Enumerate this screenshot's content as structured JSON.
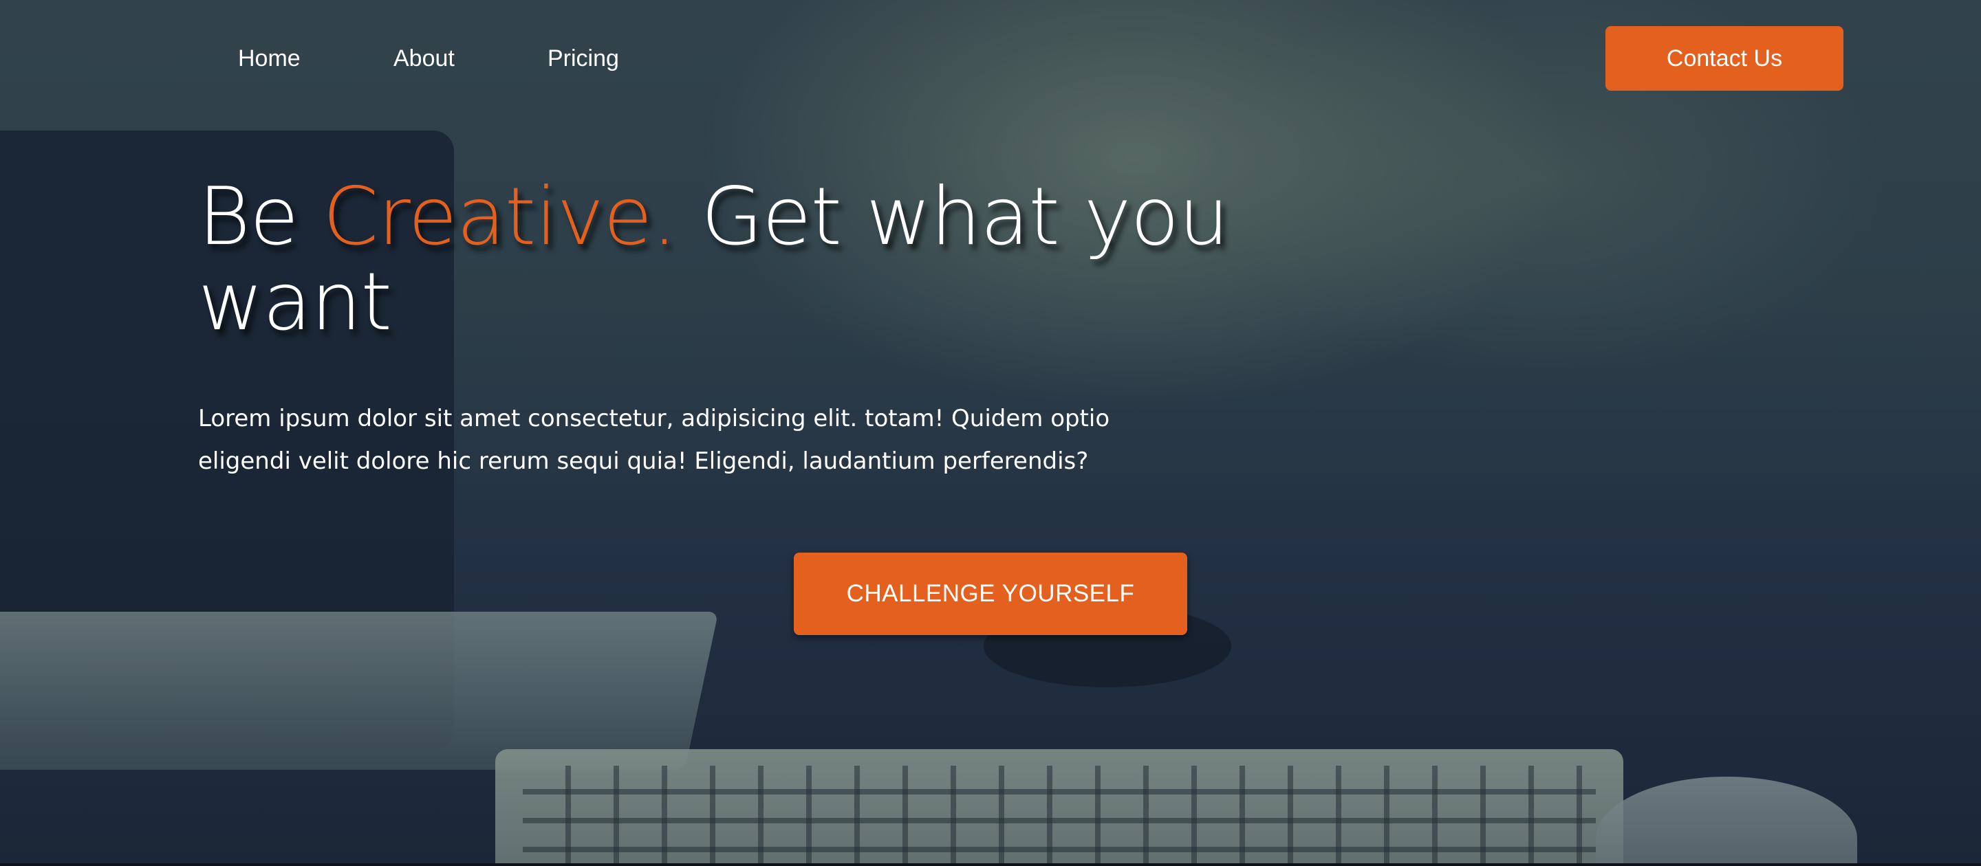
{
  "nav": {
    "links": [
      {
        "label": "Home"
      },
      {
        "label": "About"
      },
      {
        "label": "Pricing"
      }
    ],
    "contact_label": "Contact Us"
  },
  "hero": {
    "headline_prefix": "Be ",
    "headline_accent": "Creative.",
    "headline_suffix": " Get what you want",
    "lead": "Lorem ipsum dolor sit amet consectetur, adipisicing elit. totam! Quidem optio eligendi velit dolore hic rerum sequi quia! Eligendi, laudantium perferendis?",
    "cta_label": "CHALLENGE YOURSELF"
  },
  "colors": {
    "accent": "#e3601f",
    "text": "#ffffff"
  }
}
